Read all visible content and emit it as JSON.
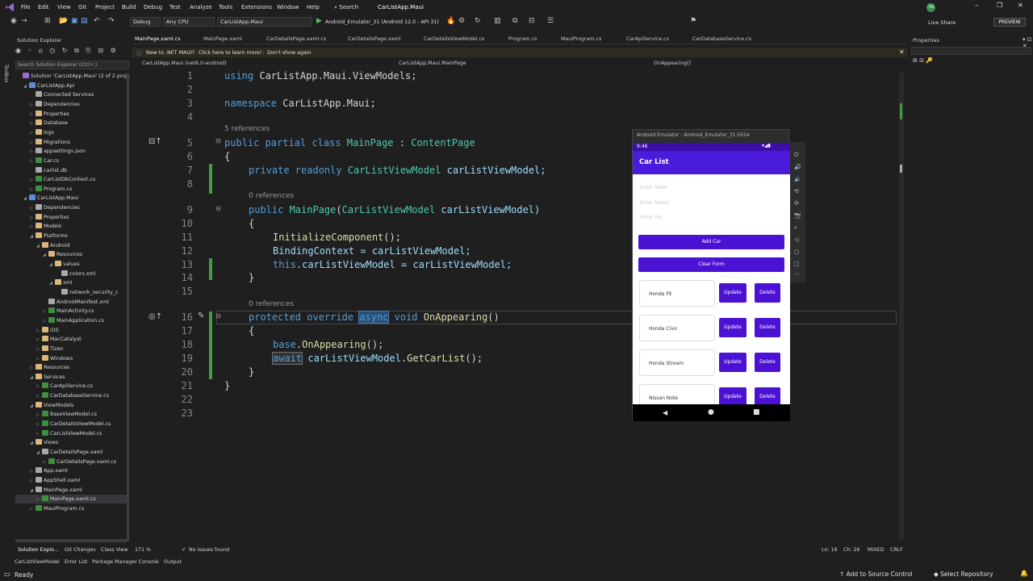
{
  "menubar": {
    "items": [
      "File",
      "Edit",
      "View",
      "Git",
      "Project",
      "Build",
      "Debug",
      "Test",
      "Analyze",
      "Tools",
      "Extensions",
      "Window",
      "Help"
    ],
    "search": "Search",
    "solution_name": "CarListApp.Maui",
    "user_initials": "TM",
    "live_share": "Live Share",
    "preview": "PREVIEW"
  },
  "toolbar": {
    "config": "Debug",
    "platform": "Any CPU",
    "startup": "CarListApp.Maui",
    "run_target": "Android_Emulator_31 (Android 12.0 - API 31)"
  },
  "left_strip": {
    "label": "Toolbox"
  },
  "solution_explorer": {
    "title": "Solution Explorer",
    "search_placeholder": "Search Solution Explorer (Ctrl+;)",
    "items": [
      {
        "label": "Solution 'CarListApp.Maui' (2 of 2 proje",
        "kind": "sol",
        "indent": 0,
        "arrow": ""
      },
      {
        "label": "CarListApp.Api",
        "kind": "proj",
        "indent": 1,
        "arrow": "◢"
      },
      {
        "label": "Connected Services",
        "kind": "file",
        "indent": 2,
        "arrow": ""
      },
      {
        "label": "Dependencies",
        "kind": "file",
        "indent": 2,
        "arrow": "▷"
      },
      {
        "label": "Properties",
        "kind": "folder",
        "indent": 2,
        "arrow": "▷"
      },
      {
        "label": "Database",
        "kind": "folder",
        "indent": 2,
        "arrow": "▷"
      },
      {
        "label": "logs",
        "kind": "folder",
        "indent": 2,
        "arrow": "▷"
      },
      {
        "label": "Migrations",
        "kind": "folder",
        "indent": 2,
        "arrow": "▷"
      },
      {
        "label": "appsettings.json",
        "kind": "file",
        "indent": 2,
        "arrow": "▷"
      },
      {
        "label": "Car.cs",
        "kind": "cs",
        "indent": 2,
        "arrow": "▷"
      },
      {
        "label": "carlist.db",
        "kind": "file",
        "indent": 2,
        "arrow": ""
      },
      {
        "label": "CarListDbContext.cs",
        "kind": "cs",
        "indent": 2,
        "arrow": "▷"
      },
      {
        "label": "Program.cs",
        "kind": "cs",
        "indent": 2,
        "arrow": "▷"
      },
      {
        "label": "CarListApp.Maui",
        "kind": "proj",
        "indent": 1,
        "arrow": "◢"
      },
      {
        "label": "Dependencies",
        "kind": "file",
        "indent": 2,
        "arrow": "▷"
      },
      {
        "label": "Properties",
        "kind": "folder",
        "indent": 2,
        "arrow": "▷"
      },
      {
        "label": "Models",
        "kind": "folder",
        "indent": 2,
        "arrow": "▷"
      },
      {
        "label": "Platforms",
        "kind": "folder",
        "indent": 2,
        "arrow": "◢"
      },
      {
        "label": "Android",
        "kind": "folder",
        "indent": 3,
        "arrow": "◢"
      },
      {
        "label": "Resources",
        "kind": "folder",
        "indent": 4,
        "arrow": "◢"
      },
      {
        "label": "values",
        "kind": "folder",
        "indent": 5,
        "arrow": "◢"
      },
      {
        "label": "colors.xml",
        "kind": "file",
        "indent": 6,
        "arrow": ""
      },
      {
        "label": "xml",
        "kind": "folder",
        "indent": 5,
        "arrow": "◢"
      },
      {
        "label": "network_security_c",
        "kind": "file",
        "indent": 6,
        "arrow": ""
      },
      {
        "label": "AndroidManifest.xml",
        "kind": "file",
        "indent": 4,
        "arrow": ""
      },
      {
        "label": "MainActivity.cs",
        "kind": "cs",
        "indent": 4,
        "arrow": "▷"
      },
      {
        "label": "MainApplication.cs",
        "kind": "cs",
        "indent": 4,
        "arrow": "▷"
      },
      {
        "label": "iOS",
        "kind": "folder",
        "indent": 3,
        "arrow": "▷"
      },
      {
        "label": "MacCatalyst",
        "kind": "folder",
        "indent": 3,
        "arrow": "▷"
      },
      {
        "label": "Tizen",
        "kind": "folder",
        "indent": 3,
        "arrow": "▷"
      },
      {
        "label": "Windows",
        "kind": "folder",
        "indent": 3,
        "arrow": "▷"
      },
      {
        "label": "Resources",
        "kind": "folder",
        "indent": 2,
        "arrow": "▷"
      },
      {
        "label": "Services",
        "kind": "folder",
        "indent": 2,
        "arrow": "◢"
      },
      {
        "label": "CarApiService.cs",
        "kind": "cs",
        "indent": 3,
        "arrow": "▷"
      },
      {
        "label": "CarDatabaseService.cs",
        "kind": "cs",
        "indent": 3,
        "arrow": "▷"
      },
      {
        "label": "ViewModels",
        "kind": "folder",
        "indent": 2,
        "arrow": "◢"
      },
      {
        "label": "BaseViewModel.cs",
        "kind": "cs",
        "indent": 3,
        "arrow": "▷"
      },
      {
        "label": "CarDetailsViewModel.cs",
        "kind": "cs",
        "indent": 3,
        "arrow": "▷"
      },
      {
        "label": "CarListViewModel.cs",
        "kind": "cs",
        "indent": 3,
        "arrow": "▷"
      },
      {
        "label": "Views",
        "kind": "folder",
        "indent": 2,
        "arrow": "◢"
      },
      {
        "label": "CarDetailsPage.xaml",
        "kind": "file",
        "indent": 3,
        "arrow": "◢"
      },
      {
        "label": "CarDetailsPage.xaml.cs",
        "kind": "cs",
        "indent": 4,
        "arrow": "▷"
      },
      {
        "label": "App.xaml",
        "kind": "file",
        "indent": 2,
        "arrow": "▷"
      },
      {
        "label": "AppShell.xaml",
        "kind": "file",
        "indent": 2,
        "arrow": "▷"
      },
      {
        "label": "MainPage.xaml",
        "kind": "file",
        "indent": 2,
        "arrow": "◢"
      },
      {
        "label": "MainPage.xaml.cs",
        "kind": "cs",
        "indent": 3,
        "arrow": "▷",
        "selected": true
      },
      {
        "label": "MauiProgram.cs",
        "kind": "cs",
        "indent": 2,
        "arrow": "▷"
      }
    ]
  },
  "editor": {
    "tabs": [
      "MainPage.xaml.cs",
      "MainPage.xaml",
      "CarDetailsPage.xaml.cs",
      "CarDetailsPage.xaml",
      "CarDetailsViewModel.cs",
      "Program.cs",
      "MauiProgram.cs",
      "CarApiService.cs",
      "CarDatabaseService.cs"
    ],
    "infobar_text": "New to .NET MAUI?",
    "infobar_link": "Click here to learn more!",
    "infobar_dismiss": "Don't show again",
    "nav_project": "CarListApp.Maui (net6.0-android)",
    "nav_class": "CarListApp.Maui.MainPage",
    "nav_member": "OnAppearing()",
    "refs_5": "5 references",
    "refs_0a": "0 references",
    "refs_0b": "0 references",
    "line_numbers": [
      "1",
      "2",
      "3",
      "4",
      "5",
      "6",
      "7",
      "8",
      "9",
      "10",
      "11",
      "12",
      "13",
      "14",
      "15",
      "16",
      "17",
      "18",
      "19",
      "20",
      "21",
      "22",
      "23"
    ],
    "code": {
      "l1a": "using ",
      "l1b": "CarListApp.Maui.ViewModels;",
      "l3a": "namespace ",
      "l3b": "CarListApp.Maui;",
      "l5a": "public partial class ",
      "l5b": "MainPage",
      "l5c": " : ",
      "l5d": "ContentPage",
      "l6": "{",
      "l7a": "private readonly ",
      "l7b": "CarListViewModel",
      "l7c": " carListViewModel;",
      "l9a": "public ",
      "l9b": "MainPage",
      "l9c": "(",
      "l9d": "CarListViewModel",
      "l9e": " carListViewModel)",
      "l10": "{",
      "l11a": "InitializeComponent",
      "l11b": "();",
      "l12a": "BindingContext",
      "l12b": " = carListViewModel;",
      "l13a": "this",
      "l13b": ".carListViewModel = carListViewModel;",
      "l14": "}",
      "l16a": "protected override ",
      "l16b": "async",
      "l16c": " void ",
      "l16d": "OnAppearing",
      "l16e": "()",
      "l17": "{",
      "l18a": "base",
      "l18b": ".",
      "l18c": "OnAppearing",
      "l18d": "();",
      "l19a": "await",
      "l19b": " carListViewModel.",
      "l19c": "GetCarList",
      "l19d": "();",
      "l20": "}",
      "l21": "}"
    }
  },
  "emulator": {
    "title": "Android Emulator - Android_Emulator_31:5554",
    "time": "9:46",
    "app_title": "Car List",
    "placeholders": [
      "Enter Make",
      "Enter Model",
      "Enter Vin"
    ],
    "add_button": "Add Car",
    "clear_button": "Clear Form",
    "cars": [
      "Honda Fit",
      "Honda Civic",
      "Honda Stream",
      "Nissan Note"
    ],
    "update_label": "Update",
    "delete_label": "Delete",
    "accent": "#4b12d3"
  },
  "properties": {
    "title": "Properties"
  },
  "bottom": {
    "zoom": "171 %",
    "issues": "No issues found",
    "cursor_line": "Ln: 16",
    "cursor_col": "Ch: 26",
    "indent": "MIXED",
    "eol": "CRLF",
    "tabs": [
      "Solution Explo...",
      "Git Changes",
      "Class View"
    ],
    "tabs2": [
      "CarListViewModel",
      "Error List",
      "Package Manager Console",
      "Output"
    ]
  },
  "status": {
    "ready": "Ready",
    "add_source": "Add to Source Control",
    "select_repo": "Select Repository"
  }
}
